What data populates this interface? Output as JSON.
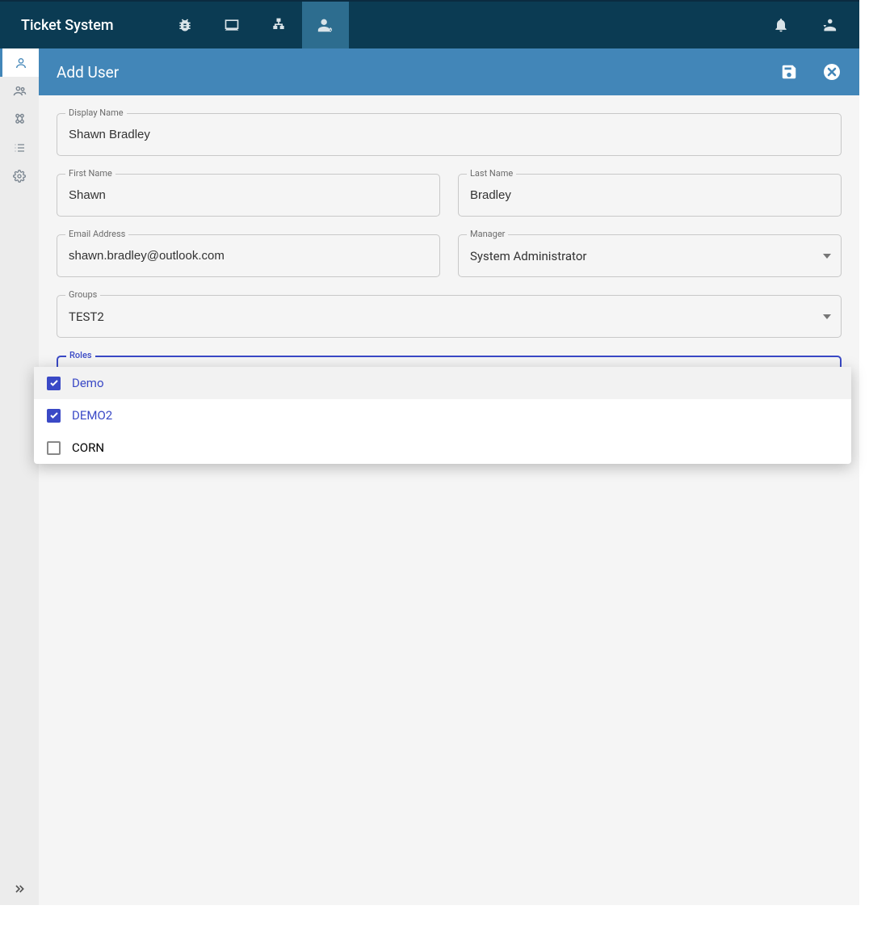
{
  "app": {
    "title": "Ticket System"
  },
  "topnav": [
    {
      "name": "bug-icon"
    },
    {
      "name": "laptop-icon"
    },
    {
      "name": "sitemap-icon"
    },
    {
      "name": "user-cog-icon",
      "active": true
    }
  ],
  "topright": [
    {
      "name": "bell-icon"
    },
    {
      "name": "user-switch-icon"
    }
  ],
  "sidebar": [
    {
      "name": "user-icon",
      "active": true
    },
    {
      "name": "group-icon"
    },
    {
      "name": "roles-icon"
    },
    {
      "name": "list-icon"
    },
    {
      "name": "gear-icon"
    }
  ],
  "page": {
    "title": "Add User"
  },
  "form": {
    "display_name": {
      "label": "Display Name",
      "value": "Shawn Bradley"
    },
    "first_name": {
      "label": "First Name",
      "value": "Shawn"
    },
    "last_name": {
      "label": "Last Name",
      "value": "Bradley"
    },
    "email": {
      "label": "Email Address",
      "value": "shawn.bradley@outlook.com"
    },
    "manager": {
      "label": "Manager",
      "value": "System Administrator"
    },
    "groups": {
      "label": "Groups",
      "value": "TEST2"
    },
    "roles": {
      "label": "Roles"
    }
  },
  "roles_options": [
    {
      "label": "Demo",
      "checked": true,
      "hover": true
    },
    {
      "label": "DEMO2",
      "checked": true,
      "hover": false
    },
    {
      "label": "CORN",
      "checked": false,
      "hover": false
    }
  ]
}
